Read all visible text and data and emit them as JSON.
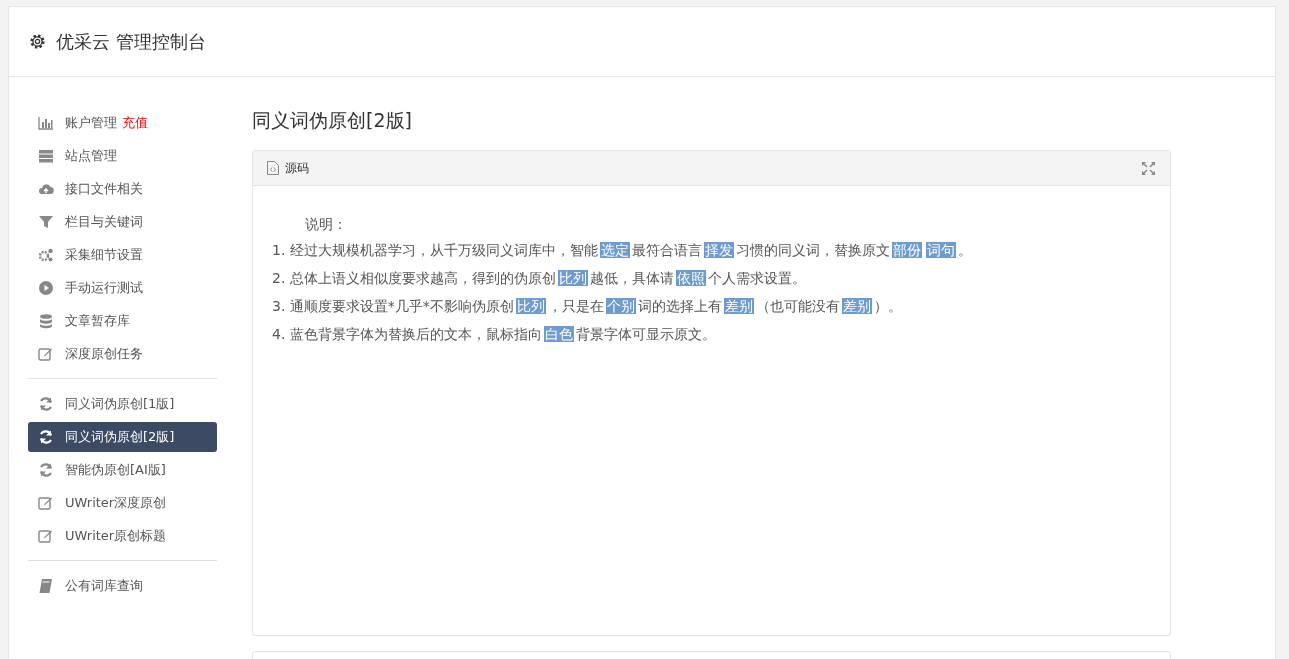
{
  "header": {
    "title": "优采云 管理控制台"
  },
  "sidebar": {
    "groups": [
      {
        "items": [
          {
            "label": "账户管理",
            "badge": "充值",
            "selected": false
          },
          {
            "label": "站点管理",
            "selected": false
          },
          {
            "label": "接口文件相关",
            "selected": false
          },
          {
            "label": "栏目与关键词",
            "selected": false
          },
          {
            "label": "采集细节设置",
            "selected": false
          },
          {
            "label": "手动运行测试",
            "selected": false
          },
          {
            "label": "文章暂存库",
            "selected": false
          },
          {
            "label": "深度原创任务",
            "selected": false
          }
        ]
      },
      {
        "items": [
          {
            "label": "同义词伪原创[1版]",
            "selected": false
          },
          {
            "label": "同义词伪原创[2版]",
            "selected": true
          },
          {
            "label": "智能伪原创[AI版]",
            "selected": false
          },
          {
            "label": "UWriter深度原创",
            "selected": false
          },
          {
            "label": "UWriter原创标题",
            "selected": false
          }
        ]
      },
      {
        "items": [
          {
            "label": "公有词库查询",
            "selected": false
          }
        ]
      }
    ]
  },
  "page_title": "同义词伪原创[2版]",
  "panel": {
    "title": "源码",
    "heading": "说明：",
    "lines": [
      [
        {
          "text": "1. 经过大规模机器学习，从千万级同义词库中，智能",
          "replaced": false
        },
        {
          "text": "选定",
          "replaced": true
        },
        {
          "text": "最符合语言",
          "replaced": false
        },
        {
          "text": "择发",
          "replaced": true
        },
        {
          "text": "习惯的同义词，替换原文",
          "replaced": false
        },
        {
          "text": "部份",
          "replaced": true
        },
        {
          "text": "词句",
          "replaced": true
        },
        {
          "text": "。",
          "replaced": false
        }
      ],
      [
        {
          "text": "2. 总体上语义相似度要求越高，得到的伪原创",
          "replaced": false
        },
        {
          "text": "比列",
          "replaced": true
        },
        {
          "text": "越低，具体请",
          "replaced": false
        },
        {
          "text": "依照",
          "replaced": true
        },
        {
          "text": "个人需求设置。",
          "replaced": false
        }
      ],
      [
        {
          "text": "3. 通顺度要求设置*几乎*不影响伪原创",
          "replaced": false
        },
        {
          "text": "比列",
          "replaced": true
        },
        {
          "text": "，只是在",
          "replaced": false
        },
        {
          "text": "个别",
          "replaced": true
        },
        {
          "text": "词的选择上有",
          "replaced": false
        },
        {
          "text": "差别",
          "replaced": true
        },
        {
          "text": "（也可能没有",
          "replaced": false
        },
        {
          "text": "差别",
          "replaced": true
        },
        {
          "text": "）。",
          "replaced": false
        }
      ],
      [
        {
          "text": "4. 蓝色背景字体为替换后的文本，鼠标指向",
          "replaced": false
        },
        {
          "text": "白色",
          "replaced": true
        },
        {
          "text": "背景字体可显示原文。",
          "replaced": false
        }
      ]
    ]
  }
}
